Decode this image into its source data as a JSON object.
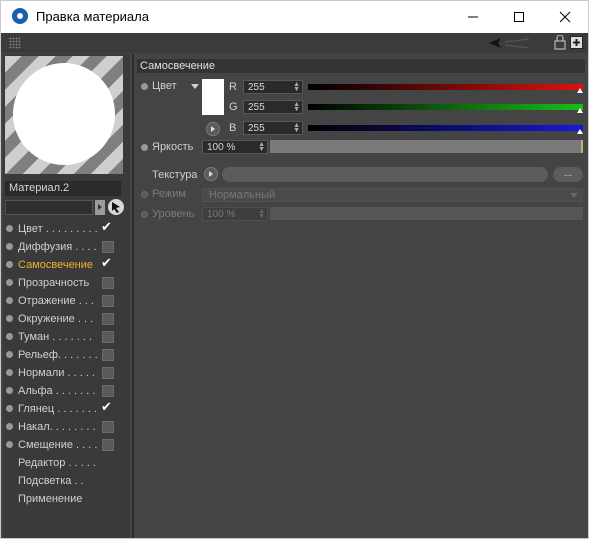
{
  "window": {
    "title": "Правка материала"
  },
  "preview": {
    "material_name": "Материал.2"
  },
  "channels": [
    {
      "label": "Цвет . . . . . . . . .",
      "checked": true,
      "active": false,
      "has_dot": true,
      "has_checkbox": true
    },
    {
      "label": "Диффузия . . . .",
      "checked": false,
      "active": false,
      "has_dot": true,
      "has_checkbox": true
    },
    {
      "label": "Самосвечение",
      "checked": true,
      "active": true,
      "has_dot": true,
      "has_checkbox": true
    },
    {
      "label": "Прозрачность",
      "checked": false,
      "active": false,
      "has_dot": true,
      "has_checkbox": true
    },
    {
      "label": "Отражение . . .",
      "checked": false,
      "active": false,
      "has_dot": true,
      "has_checkbox": true
    },
    {
      "label": "Окружение . . .",
      "checked": false,
      "active": false,
      "has_dot": true,
      "has_checkbox": true
    },
    {
      "label": "Туман . . . . . . .",
      "checked": false,
      "active": false,
      "has_dot": true,
      "has_checkbox": true
    },
    {
      "label": "Рельеф. . . . . . .",
      "checked": false,
      "active": false,
      "has_dot": true,
      "has_checkbox": true
    },
    {
      "label": "Нормали . . . . .",
      "checked": false,
      "active": false,
      "has_dot": true,
      "has_checkbox": true
    },
    {
      "label": "Альфа . . . . . . .",
      "checked": false,
      "active": false,
      "has_dot": true,
      "has_checkbox": true
    },
    {
      "label": "Глянец . . . . . . .",
      "checked": true,
      "active": false,
      "has_dot": true,
      "has_checkbox": true
    },
    {
      "label": "Накал. . . . . . . .",
      "checked": false,
      "active": false,
      "has_dot": true,
      "has_checkbox": true
    },
    {
      "label": "Смещение . . . .",
      "checked": false,
      "active": false,
      "has_dot": true,
      "has_checkbox": true
    },
    {
      "label": "Редактор . . . . .",
      "checked": false,
      "active": false,
      "has_dot": false,
      "has_checkbox": false
    },
    {
      "label": "Подсветка . .",
      "checked": false,
      "active": false,
      "has_dot": false,
      "has_checkbox": false
    },
    {
      "label": "Применение",
      "checked": false,
      "active": false,
      "has_dot": false,
      "has_checkbox": false
    }
  ],
  "section": {
    "title": "Самосвечение",
    "color": {
      "label": "Цвет",
      "swatch": "#ffffff",
      "r_label": "R",
      "r_value": "255",
      "g_label": "G",
      "g_value": "255",
      "b_label": "B",
      "b_value": "255"
    },
    "brightness": {
      "label": "Яркость",
      "value": "100 %",
      "level": 1.0
    },
    "texture": {
      "label": "Текстура",
      "more_label": "..."
    },
    "mode": {
      "label": "Режим",
      "value": "Нормальный"
    },
    "level": {
      "label": "Уровень",
      "value": "100 %"
    }
  },
  "colors": {
    "panel_bg": "#444444",
    "active_channel": "#f0b030"
  }
}
